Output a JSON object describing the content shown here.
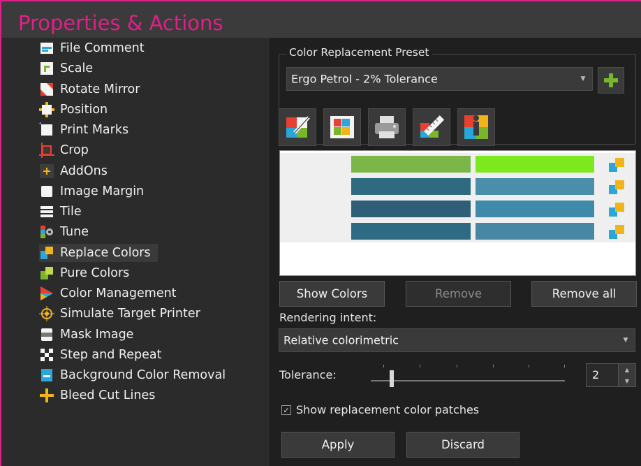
{
  "title": "Properties & Actions",
  "nav_items": [
    {
      "label": "File Comment",
      "icon": "file-comment-icon"
    },
    {
      "label": "Scale",
      "icon": "scale-icon"
    },
    {
      "label": "Rotate Mirror",
      "icon": "rotate-mirror-icon"
    },
    {
      "label": "Position",
      "icon": "position-icon"
    },
    {
      "label": "Print Marks",
      "icon": "print-marks-icon"
    },
    {
      "label": "Crop",
      "icon": "crop-icon"
    },
    {
      "label": "AddOns",
      "icon": "addons-icon"
    },
    {
      "label": "Image Margin",
      "icon": "image-margin-icon"
    },
    {
      "label": "Tile",
      "icon": "tile-icon"
    },
    {
      "label": "Tune",
      "icon": "tune-icon"
    },
    {
      "label": "Replace Colors",
      "icon": "replace-colors-icon",
      "selected": true
    },
    {
      "label": "Pure Colors",
      "icon": "pure-colors-icon"
    },
    {
      "label": "Color Management",
      "icon": "color-management-icon"
    },
    {
      "label": "Simulate Target Printer",
      "icon": "simulate-target-printer-icon"
    },
    {
      "label": "Mask Image",
      "icon": "mask-image-icon"
    },
    {
      "label": "Step and Repeat",
      "icon": "step-and-repeat-icon"
    },
    {
      "label": "Background Color Removal",
      "icon": "background-color-removal-icon"
    },
    {
      "label": "Bleed Cut Lines",
      "icon": "bleed-cut-lines-icon"
    }
  ],
  "preset": {
    "group_label": "Color Replacement Preset",
    "value": "Ergo Petrol - 2% Tolerance",
    "add_icon": "plus-icon"
  },
  "toolbar_icons": [
    "color-picker-icon",
    "swatch-palette-icon",
    "printer-icon",
    "measure-ruler-icon",
    "color-info-icon"
  ],
  "replacements": [
    {
      "source": "#7ab648",
      "target": "#7be91c"
    },
    {
      "source": "#2e6a80",
      "target": "#4a8faa"
    },
    {
      "source": "#2f5f78",
      "target": "#3f8aa8"
    },
    {
      "source": "#2f6a84",
      "target": "#4787a3"
    }
  ],
  "buttons": {
    "show_colors": "Show Colors",
    "remove": "Remove",
    "remove_all": "Remove all",
    "apply": "Apply",
    "discard": "Discard"
  },
  "rendering": {
    "label": "Rendering intent:",
    "value": "Relative colorimetric"
  },
  "tolerance": {
    "label": "Tolerance:",
    "value": "2"
  },
  "show_patches": {
    "label": "Show replacement color patches",
    "checked": true,
    "mark": "✓"
  },
  "colors": {
    "accent": "#e0208a"
  }
}
